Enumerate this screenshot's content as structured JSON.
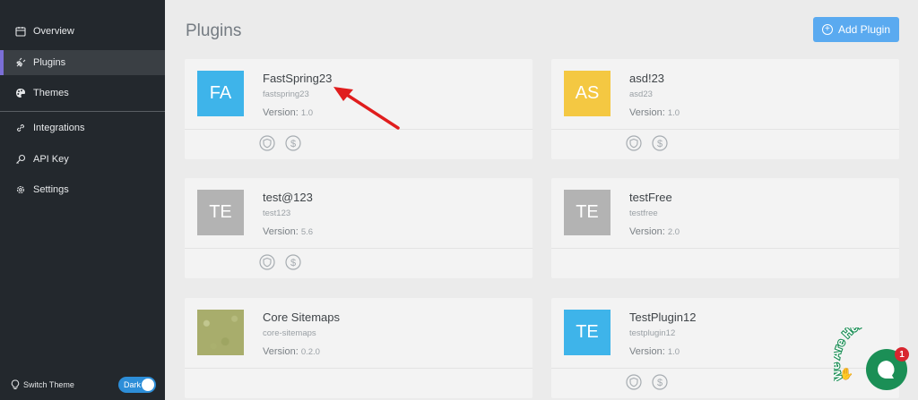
{
  "sidebar": {
    "items": [
      {
        "label": "Overview",
        "icon": "calendar-icon"
      },
      {
        "label": "Plugins",
        "icon": "plug-icon",
        "active": true
      },
      {
        "label": "Themes",
        "icon": "palette-icon"
      },
      {
        "label": "Integrations",
        "icon": "link-icon"
      },
      {
        "label": "API Key",
        "icon": "key-icon"
      },
      {
        "label": "Settings",
        "icon": "gear-icon"
      }
    ],
    "switch_theme_label": "Switch Theme",
    "toggle_label": "Dark"
  },
  "header": {
    "title": "Plugins",
    "add_button_label": "Add Plugin"
  },
  "plugins": [
    {
      "initials": "FA",
      "name": "FastSpring23",
      "slug": "fastspring23",
      "version_label": "Version:",
      "version": "1.0",
      "avatar_color": "#3eb4ea",
      "has_actions": true
    },
    {
      "initials": "AS",
      "name": "asd!23",
      "slug": "asd23",
      "version_label": "Version:",
      "version": "1.0",
      "avatar_color": "#f4c842",
      "has_actions": true
    },
    {
      "initials": "TE",
      "name": "test@123",
      "slug": "test123",
      "version_label": "Version:",
      "version": "5.6",
      "avatar_color": "#b3b3b3",
      "has_actions": true
    },
    {
      "initials": "TE",
      "name": "testFree",
      "slug": "testfree",
      "version_label": "Version:",
      "version": "2.0",
      "avatar_color": "#b3b3b3",
      "has_actions": false
    },
    {
      "initials": "",
      "name": "Core Sitemaps",
      "slug": "core-sitemaps",
      "version_label": "Version:",
      "version": "0.2.0",
      "avatar_color": "#a8ad6c",
      "has_actions": false
    },
    {
      "initials": "TE",
      "name": "TestPlugin12",
      "slug": "testplugin12",
      "version_label": "Version:",
      "version": "1.0",
      "avatar_color": "#3eb4ea",
      "has_actions": true
    }
  ],
  "chat": {
    "banner": "We Are Here!",
    "badge_count": "1"
  },
  "colors": {
    "sidebar_bg": "#23282d",
    "accent": "#5aaaf0",
    "annotation_arrow": "#e01d1d",
    "chat_green": "#1b8f56"
  }
}
